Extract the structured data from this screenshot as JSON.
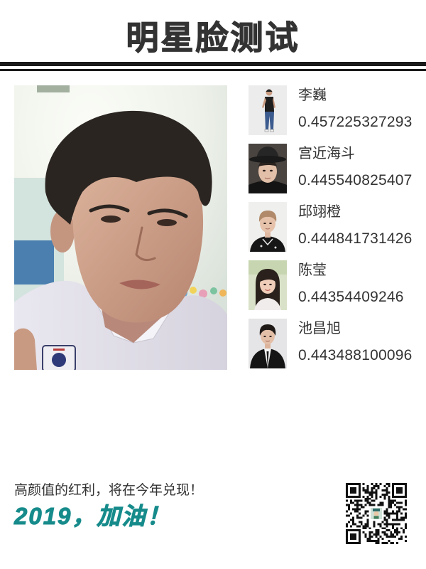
{
  "header": {
    "title": "明星脸测试"
  },
  "results": [
    {
      "name": "李巍",
      "score": "0.457225327293"
    },
    {
      "name": "宫近海斗",
      "score": "0.445540825407"
    },
    {
      "name": "邱翊橙",
      "score": "0.444841731426"
    },
    {
      "name": "陈莹",
      "score": "0.44354409246"
    },
    {
      "name": "池昌旭",
      "score": "0.443488100096"
    }
  ],
  "footer": {
    "slogan": "高颜值的红利，将在今年兑现！",
    "headline": "2019，加油！"
  },
  "colors": {
    "text": "#333333",
    "rule": "#1a1a1a",
    "accent": "#178b8b",
    "background": "#ffffff"
  }
}
